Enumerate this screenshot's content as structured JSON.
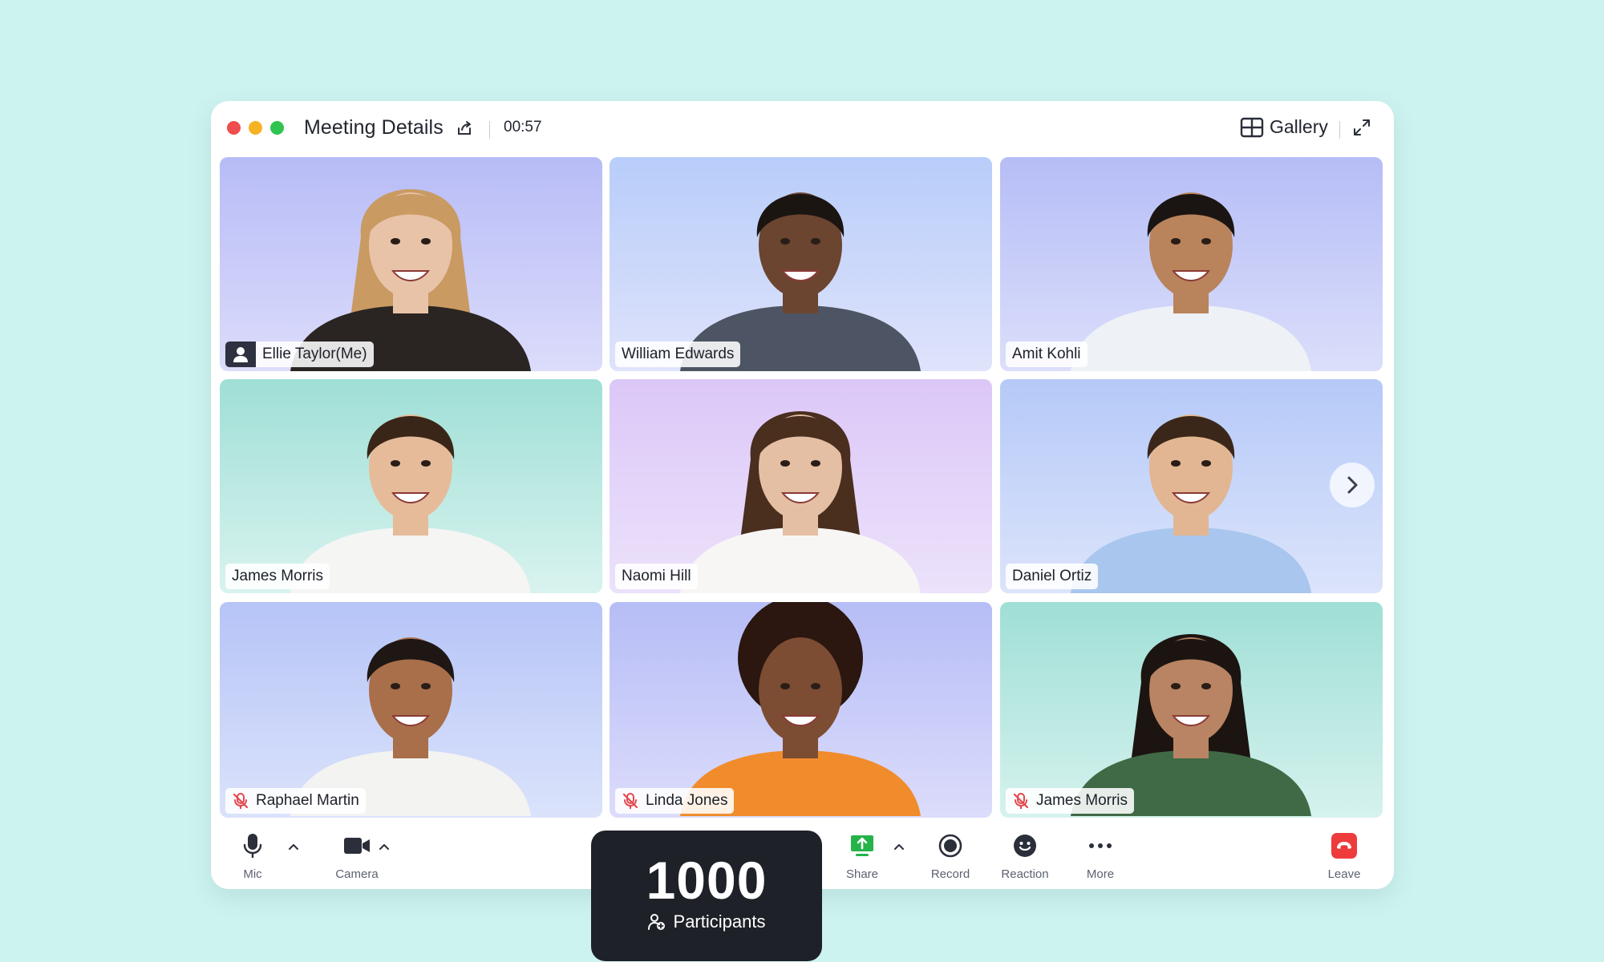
{
  "window": {
    "title": "Meeting Details",
    "timer": "00:57",
    "view_mode": "Gallery"
  },
  "participants_grid": [
    {
      "name": "Ellie Taylor(Me)",
      "is_me": true,
      "muted": false,
      "bg": [
        "#b7bcf6",
        "#dcdcfb"
      ]
    },
    {
      "name": "William Edwards",
      "is_me": false,
      "muted": false,
      "bg": [
        "#b8cdfa",
        "#dfe3fb"
      ]
    },
    {
      "name": "Amit Kohli",
      "is_me": false,
      "muted": false,
      "bg": [
        "#b6bdf6",
        "#dbdffb"
      ]
    },
    {
      "name": "James Morris",
      "is_me": false,
      "muted": false,
      "bg": [
        "#9fdfd6",
        "#d9f3ef"
      ]
    },
    {
      "name": "Naomi Hill",
      "is_me": false,
      "muted": false,
      "bg": [
        "#dcc7f8",
        "#ece2fb"
      ]
    },
    {
      "name": "Daniel Ortiz",
      "is_me": false,
      "muted": false,
      "bg": [
        "#b5c9f8",
        "#dce4fb"
      ]
    },
    {
      "name": "Raphael Martin",
      "is_me": false,
      "muted": true,
      "bg": [
        "#b6c4f7",
        "#dbe3fb"
      ]
    },
    {
      "name": "Linda Jones",
      "is_me": false,
      "muted": true,
      "bg": [
        "#b6bdf6",
        "#dcdcfb"
      ]
    },
    {
      "name": "James Morris",
      "is_me": false,
      "muted": true,
      "bg": [
        "#9fdfd6",
        "#d6f2ee"
      ]
    }
  ],
  "toolbar": {
    "mic_label": "Mic",
    "camera_label": "Camera",
    "share_label": "Share",
    "record_label": "Record",
    "reaction_label": "Reaction",
    "more_label": "More",
    "leave_label": "Leave"
  },
  "participants_card": {
    "count": "1000",
    "label": "Participants"
  },
  "colors": {
    "page_bg": "#cdf3ef",
    "leave_red": "#ee3b3b",
    "share_green": "#25b34a",
    "card_dark": "#1e2128",
    "mute_red": "#e5484d"
  }
}
